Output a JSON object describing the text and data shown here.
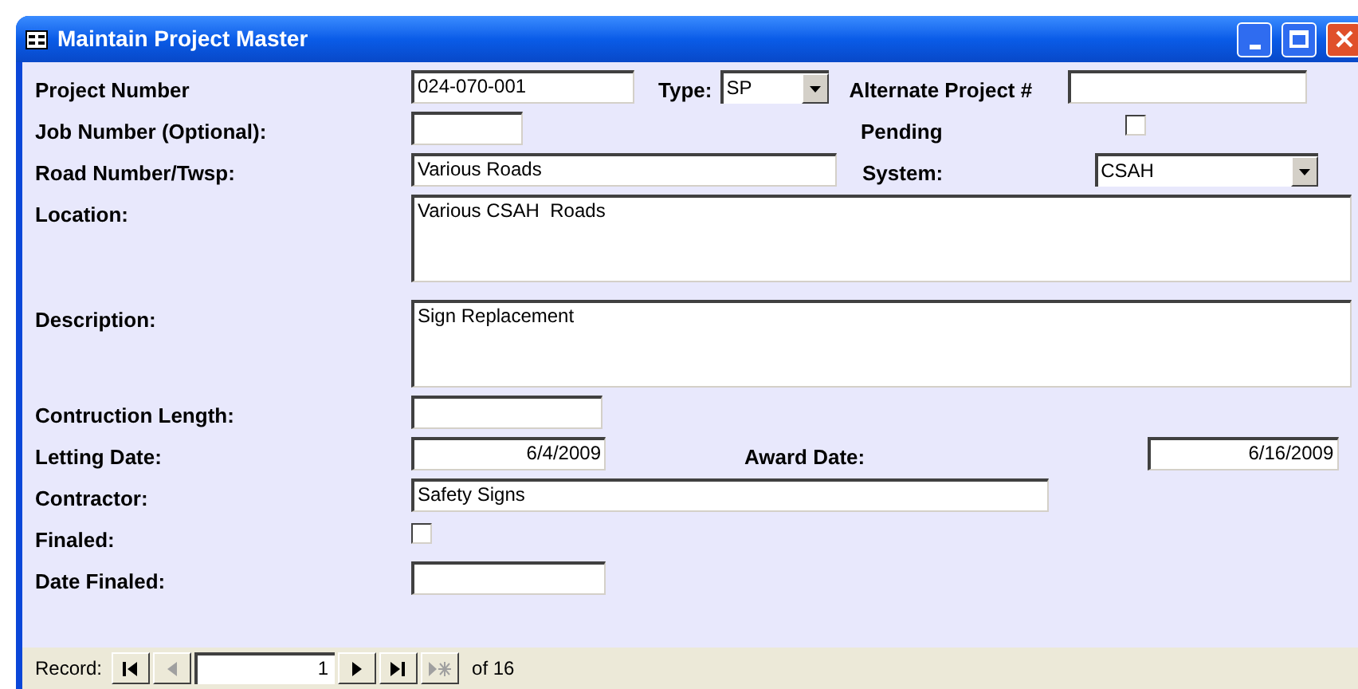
{
  "window": {
    "title": "Maintain Project Master"
  },
  "rows": [
    {
      "kind": "fields",
      "items": [
        {
          "kind": "label",
          "text": "Project Number"
        },
        {
          "kind": "input",
          "value": "024-070-001"
        },
        {
          "kind": "label",
          "text": "Type:"
        },
        {
          "kind": "select",
          "value": "SP"
        },
        {
          "kind": "label",
          "text": "Alternate Project #"
        },
        {
          "kind": "input",
          "value": ""
        }
      ]
    },
    {
      "kind": "fields",
      "items": [
        {
          "kind": "label",
          "text": "Job Number (Optional):"
        },
        {
          "kind": "input",
          "value": ""
        },
        {
          "kind": "label",
          "text": "Pending"
        },
        {
          "kind": "checkbox",
          "checked": false
        }
      ]
    },
    {
      "kind": "fields",
      "items": [
        {
          "kind": "label",
          "text": "Road Number/Twsp:"
        },
        {
          "kind": "input",
          "value": "Various Roads"
        },
        {
          "kind": "label",
          "text": "System:"
        },
        {
          "kind": "select",
          "value": "CSAH"
        }
      ]
    },
    {
      "kind": "memo",
      "items": [
        {
          "kind": "label",
          "text": "Location:"
        },
        {
          "kind": "input",
          "value": "Various CSAH  Roads"
        }
      ]
    },
    {
      "kind": "memo",
      "items": [
        {
          "kind": "label",
          "text": "Description:"
        },
        {
          "kind": "input",
          "value": "Sign Replacement"
        }
      ]
    },
    {
      "kind": "fields",
      "items": [
        {
          "kind": "label",
          "text": "Contruction Length:"
        },
        {
          "kind": "input",
          "value": ""
        }
      ]
    },
    {
      "kind": "fields",
      "items": [
        {
          "kind": "label",
          "text": "Letting Date:"
        },
        {
          "kind": "date",
          "value": "6/4/2009"
        },
        {
          "kind": "label",
          "text": "Award Date:"
        },
        {
          "kind": "date",
          "value": "6/16/2009"
        }
      ]
    },
    {
      "kind": "fields",
      "items": [
        {
          "kind": "label",
          "text": "Contractor:"
        },
        {
          "kind": "input",
          "value": "Safety Signs"
        }
      ]
    },
    {
      "kind": "fields",
      "items": [
        {
          "kind": "label",
          "text": "Finaled:"
        },
        {
          "kind": "checkbox",
          "checked": false
        }
      ]
    },
    {
      "kind": "fields",
      "items": [
        {
          "kind": "label",
          "text": "Date Finaled:"
        },
        {
          "kind": "input",
          "value": ""
        }
      ]
    }
  ],
  "navigator": {
    "label": "Record:",
    "current": "1",
    "total": "of 16",
    "buttons": [
      {
        "kind": "first",
        "disabled": false
      },
      {
        "kind": "prev",
        "disabled": true
      },
      {
        "kind": "next",
        "disabled": false
      },
      {
        "kind": "last",
        "disabled": false
      },
      {
        "kind": "new",
        "disabled": true
      }
    ]
  }
}
